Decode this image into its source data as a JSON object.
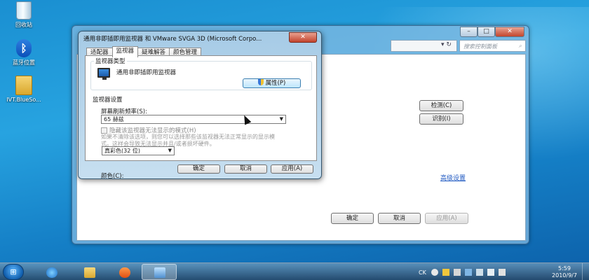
{
  "desktop": {
    "icons": [
      {
        "label": "回收站",
        "icon": "recycle-bin-icon"
      },
      {
        "label": "蓝牙位置",
        "icon": "bluetooth-icon"
      },
      {
        "label": "IVT.BlueSo...",
        "icon": "folder-icon"
      }
    ]
  },
  "background_window": {
    "search_placeholder": "搜索控制面板",
    "detect_button": "检测(C)",
    "identify_button": "识别(I)",
    "advanced_link": "高级设置",
    "ok_button": "确定",
    "cancel_button": "取消",
    "apply_button": "应用(A)"
  },
  "dialog": {
    "title": "通用非即插即用监视器 和 VMware SVGA 3D (Microsoft Corpo...",
    "close_label": "✕",
    "tabs": [
      "适配器",
      "监视器",
      "疑难解答",
      "颜色管理"
    ],
    "active_tab": "监视器",
    "monitor_type_group": "监视器类型",
    "monitor_name": "通用非即插即用监视器",
    "properties_button": "属性(P)",
    "monitor_settings_group": "监视器设置",
    "refresh_label": "屏幕刷新频率(S):",
    "refresh_value": "65 赫兹",
    "hide_modes_label": "隐藏该监视器无法显示的模式(H)",
    "hide_modes_desc": "如果不清除该选项，则您可以选择那些该监视器无法正常显示的显示模式。这样会导致无法显示并且/或者损坏硬件。",
    "colors_label": "颜色(C):",
    "colors_value": "真彩色(32 位)",
    "ok_button": "确定",
    "cancel_button": "取消",
    "apply_button": "应用(A)"
  },
  "taskbar": {
    "language": "CK",
    "time": "5:59",
    "date": "2010/9/7"
  }
}
